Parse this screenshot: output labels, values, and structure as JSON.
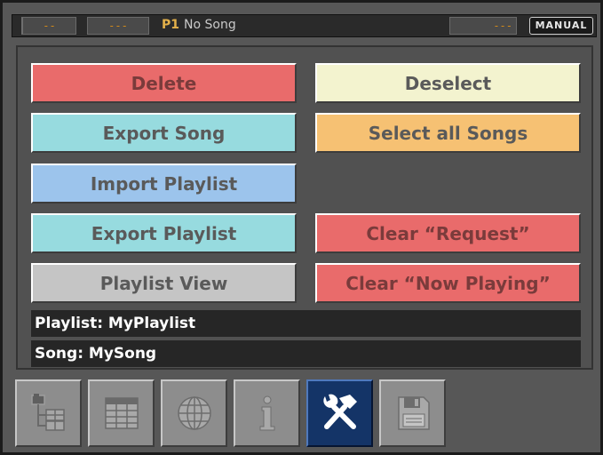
{
  "statusbar": {
    "seg_a": "--",
    "seg_b": "---",
    "slot_number": "P1",
    "song_title": "No Song",
    "seg_right": "---",
    "mode": "MANUAL"
  },
  "buttons": {
    "delete": "Delete",
    "deselect": "Deselect",
    "export_song": "Export Song",
    "select_all_songs": "Select all Songs",
    "import_playlist": "Import Playlist",
    "export_playlist": "Export Playlist",
    "clear_request": "Clear “Request”",
    "playlist_view": "Playlist View",
    "clear_now_playing": "Clear “Now Playing”"
  },
  "info": {
    "playlist": "Playlist: MyPlaylist",
    "song": "Song: MySong"
  },
  "toolbar": {
    "tools": [
      {
        "icon": "tree-view-icon",
        "active": false
      },
      {
        "icon": "list-view-icon",
        "active": false
      },
      {
        "icon": "globe-icon",
        "active": false
      },
      {
        "icon": "info-icon",
        "active": false
      },
      {
        "icon": "tools-icon",
        "active": true
      },
      {
        "icon": "save-disk-icon",
        "active": false
      }
    ]
  },
  "colors": {
    "red_button": "#e96b6b",
    "cream_button": "#f3f3cf",
    "cyan_button": "#97dbdf",
    "orange_button": "#f6c173",
    "blue_button": "#9cc4ec",
    "grey_button": "#c5c5c5",
    "active_tool": "#143467"
  }
}
